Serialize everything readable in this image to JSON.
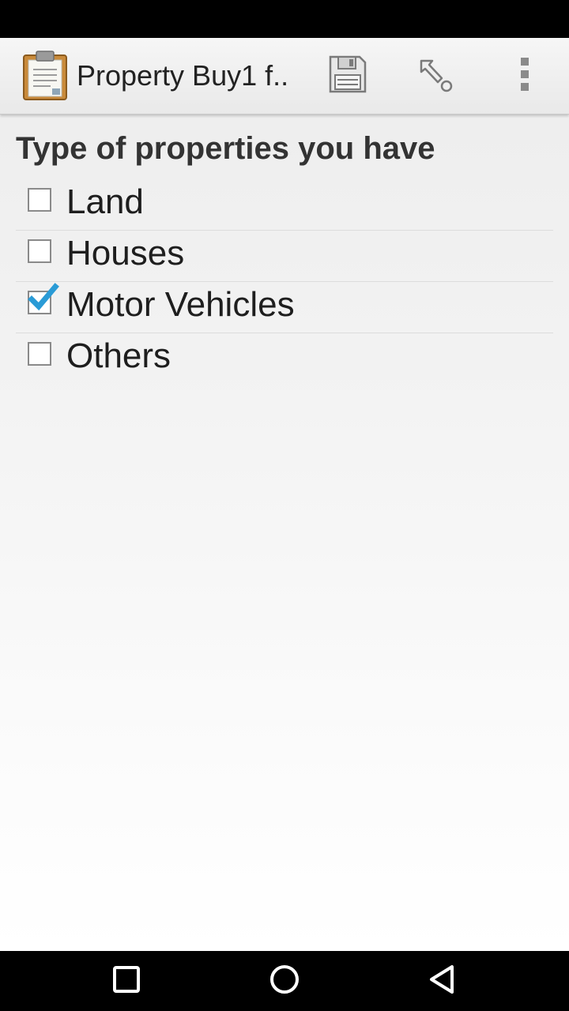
{
  "action_bar": {
    "title": "Property Buy1 f..",
    "icons": [
      "clipboard-app-icon",
      "save-icon",
      "pointer-icon",
      "overflow-menu-icon"
    ]
  },
  "form": {
    "section_title": "Type of properties you have",
    "options": [
      {
        "label": "Land",
        "checked": false
      },
      {
        "label": "Houses",
        "checked": false
      },
      {
        "label": "Motor Vehicles",
        "checked": true
      },
      {
        "label": "Others",
        "checked": false
      }
    ]
  },
  "nav_bar": {
    "icons": [
      "recent-apps-icon",
      "home-icon",
      "back-icon"
    ]
  },
  "colors": {
    "check_accent": "#2a9bd6",
    "action_bar": "#efefef"
  }
}
